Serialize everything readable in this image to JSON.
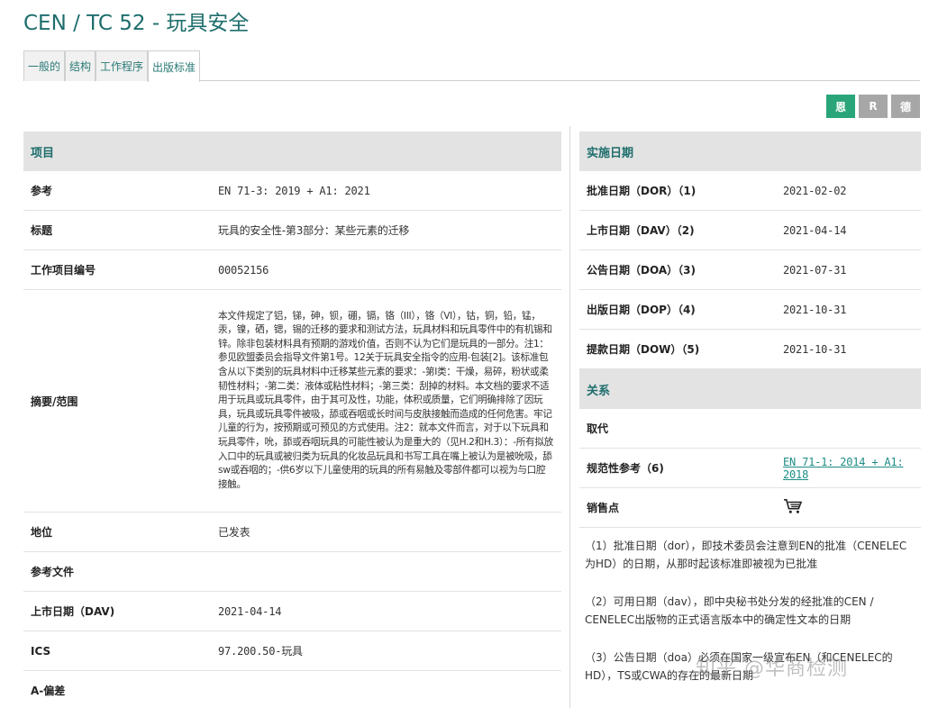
{
  "title": "CEN / TC 52 - 玩具安全",
  "tabs": [
    {
      "label": "一般的"
    },
    {
      "label": "结构"
    },
    {
      "label": "工作程序"
    },
    {
      "label": "出版标准"
    }
  ],
  "toolbar": {
    "btn1": "恩",
    "btn2": "R",
    "btn3": "德"
  },
  "left": {
    "header": "项目",
    "rows": [
      {
        "key": "参考",
        "value": "EN 71-3: 2019 + A1: 2021"
      },
      {
        "key": "标题",
        "value": "玩具的安全性-第3部分：某些元素的迁移"
      },
      {
        "key": "工作项目编号",
        "value": "00052156"
      },
      {
        "key": "摘要/范围",
        "value": "本文件规定了铝，锑，砷，钡，硼，镉，铬（III），铬（VI），钴，铜，铅，锰，汞，镍，硒，锶，锡的迁移的要求和测试方法，玩具材料和玩具零件中的有机锡和锌。除非包装材料具有预期的游戏价值，否则不认为它们是玩具的一部分。注1：参见欧盟委员会指导文件第1号。12关于玩具安全指令的应用-包装[2]。该标准包含从以下类别的玩具材料中迁移某些元素的要求：-第I类：干燥，易碎，粉状或柔韧性材料；-第二类：液体或粘性材料；-第三类：刮掉的材料。本文档的要求不适用于玩具或玩具零件，由于其可及性，功能，体积或质量，它们明确排除了因玩具，玩具或玩具零件被吸，舔或吞咽或长时间与皮肤接触而造成的任何危害。牢记儿童的行为，按预期或可预见的方式使用。注2：就本文件而言，对于以下玩具和玩具零件，吮，舔或吞咽玩具的可能性被认为是重大的（见H.2和H.3）：-所有拟放入口中的玩具或被归类为玩具的化妆品玩具和书写工具在嘴上被认为是被吮吸，舔sw或吞咽的；-供6岁以下儿童使用的玩具的所有易触及零部件都可以视为与口腔接触。"
      },
      {
        "key": "地位",
        "value": "已发表"
      },
      {
        "key": "参考文件",
        "value": ""
      },
      {
        "key": "上市日期（DAV)",
        "value": "2021-04-14"
      },
      {
        "key": "ICS",
        "value": "97.200.50-玩具"
      },
      {
        "key": "A-偏差",
        "value": ""
      }
    ]
  },
  "right": {
    "header": "实施日期",
    "rows": [
      {
        "key": "批准日期（DOR）（1)",
        "value": "2021-02-02"
      },
      {
        "key": "上市日期（DAV）（2)",
        "value": "2021-04-14"
      },
      {
        "key": "公告日期（DOA）（3)",
        "value": "2021-07-31"
      },
      {
        "key": "出版日期（DOP）（4)",
        "value": "2021-10-31"
      },
      {
        "key": "提款日期（DOW）（5)",
        "value": "2021-10-31"
      }
    ],
    "rel_header": "关系",
    "rel_rows": {
      "replaces": "取代",
      "normative_key": "规范性参考（6)",
      "normative_link": "EN 71-1: 2014 + A1: 2018",
      "sales": "销售点",
      "cart_icon": "shopping-cart-icon"
    },
    "notes": [
      "（1）批准日期（dor），即技术委员会注意到EN的批准（CENELEC为HD）的日期，从那时起该标准即被视为已批准",
      "（2）可用日期（dav），即中央秘书处分发的经批准的CEN / CENELEC出版物的正式语言版本中的确定性文本的日期",
      "（3）公告日期（doa）必须在国家一级宣布EN（和CENELEC的HD），TS或CWA的存在的最新日期"
    ]
  },
  "watermark": "知乎 @华商检测",
  "colors": {
    "accent": "#1e6e6c",
    "green_button": "#2aa57a",
    "grey_button": "#a7a7a7",
    "section_bg": "#e3e3e3"
  }
}
